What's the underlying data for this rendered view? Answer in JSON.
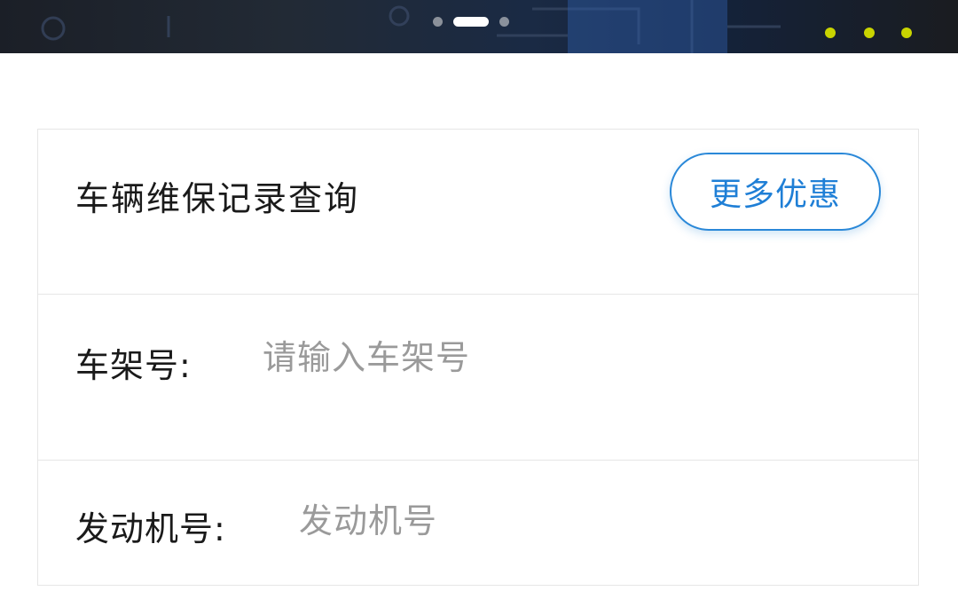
{
  "banner": {
    "pager": {
      "count": 3,
      "active_index": 1
    }
  },
  "query": {
    "title": "车辆维保记录查询",
    "promo_button_label": "更多优惠",
    "vin": {
      "label": "车架号:",
      "value": "",
      "placeholder": "请输入车架号"
    },
    "engine": {
      "label": "发动机号:",
      "value": "",
      "placeholder": "发动机号"
    }
  },
  "colors": {
    "accent": "#1f7fd6",
    "placeholder": "#9a9a9a",
    "divider": "#e6e6e6",
    "banner_dark": "#1b1f27"
  }
}
